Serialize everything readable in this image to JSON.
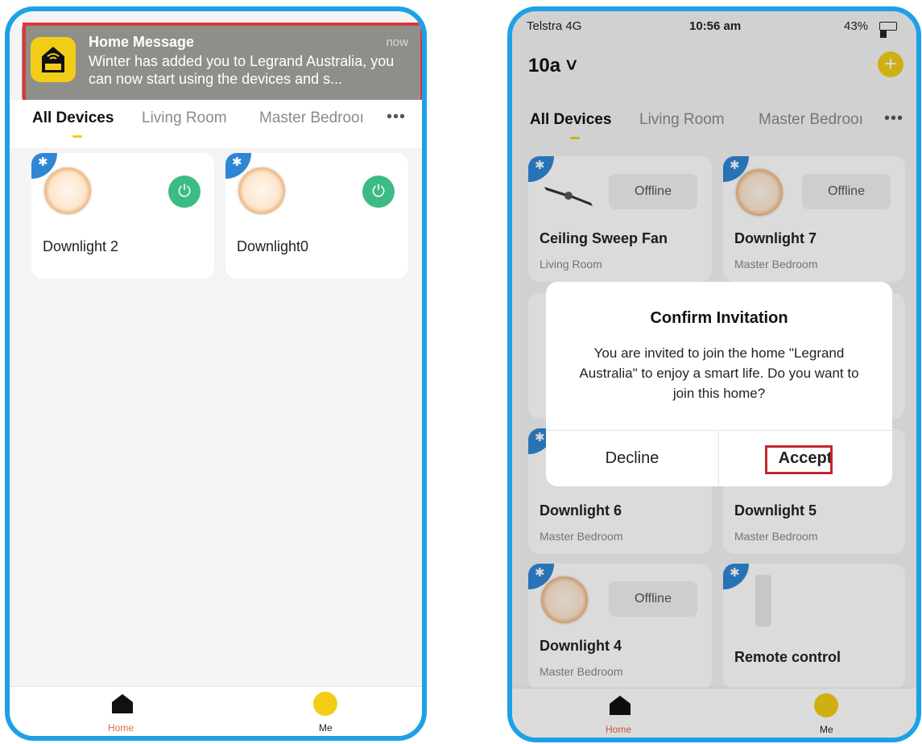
{
  "left": {
    "notification": {
      "title": "Home Message",
      "time": "now",
      "body": "Winter has added you to Legrand Australia, you can now start using the devices and s..."
    },
    "tabs": [
      "All Devices",
      "Living Room",
      "Master Bedrooı"
    ],
    "devices": [
      {
        "name": "Downlight 2"
      },
      {
        "name": "Downlight0"
      }
    ],
    "nav": {
      "home": "Home",
      "me": "Me"
    }
  },
  "right": {
    "status": {
      "carrier": "Telstra 4G",
      "time": "10:56 am",
      "battery": "43%"
    },
    "home_name": "10a ˅",
    "tabs": [
      "All Devices",
      "Living Room",
      "Master Bedrooı"
    ],
    "offline_label": "Offline",
    "devices": [
      {
        "name": "Ceiling Sweep Fan",
        "room": "Living Room"
      },
      {
        "name": "Downlight 7",
        "room": "Master Bedroom"
      },
      {
        "name": "Downlight 6",
        "room": "Master Bedroom"
      },
      {
        "name": "Downlight 5",
        "room": "Master Bedroom"
      },
      {
        "name": "Downlight 4",
        "room": "Master Bedroom"
      },
      {
        "name": "Remote control"
      }
    ],
    "dialog": {
      "title": "Confirm Invitation",
      "message": "You are invited to join the home \"Legrand Australia\" to enjoy a smart life. Do you want to join this home?",
      "decline": "Decline",
      "accept": "Accept"
    },
    "nav": {
      "home": "Home",
      "me": "Me"
    }
  },
  "colors": {
    "frame": "#1da1e6",
    "brand_yellow": "#f2cd18",
    "power_green": "#3dbb84",
    "bluetooth_blue": "#2f86d4",
    "highlight_red": "#d9383a",
    "nav_active_red": "#e06a4a"
  }
}
